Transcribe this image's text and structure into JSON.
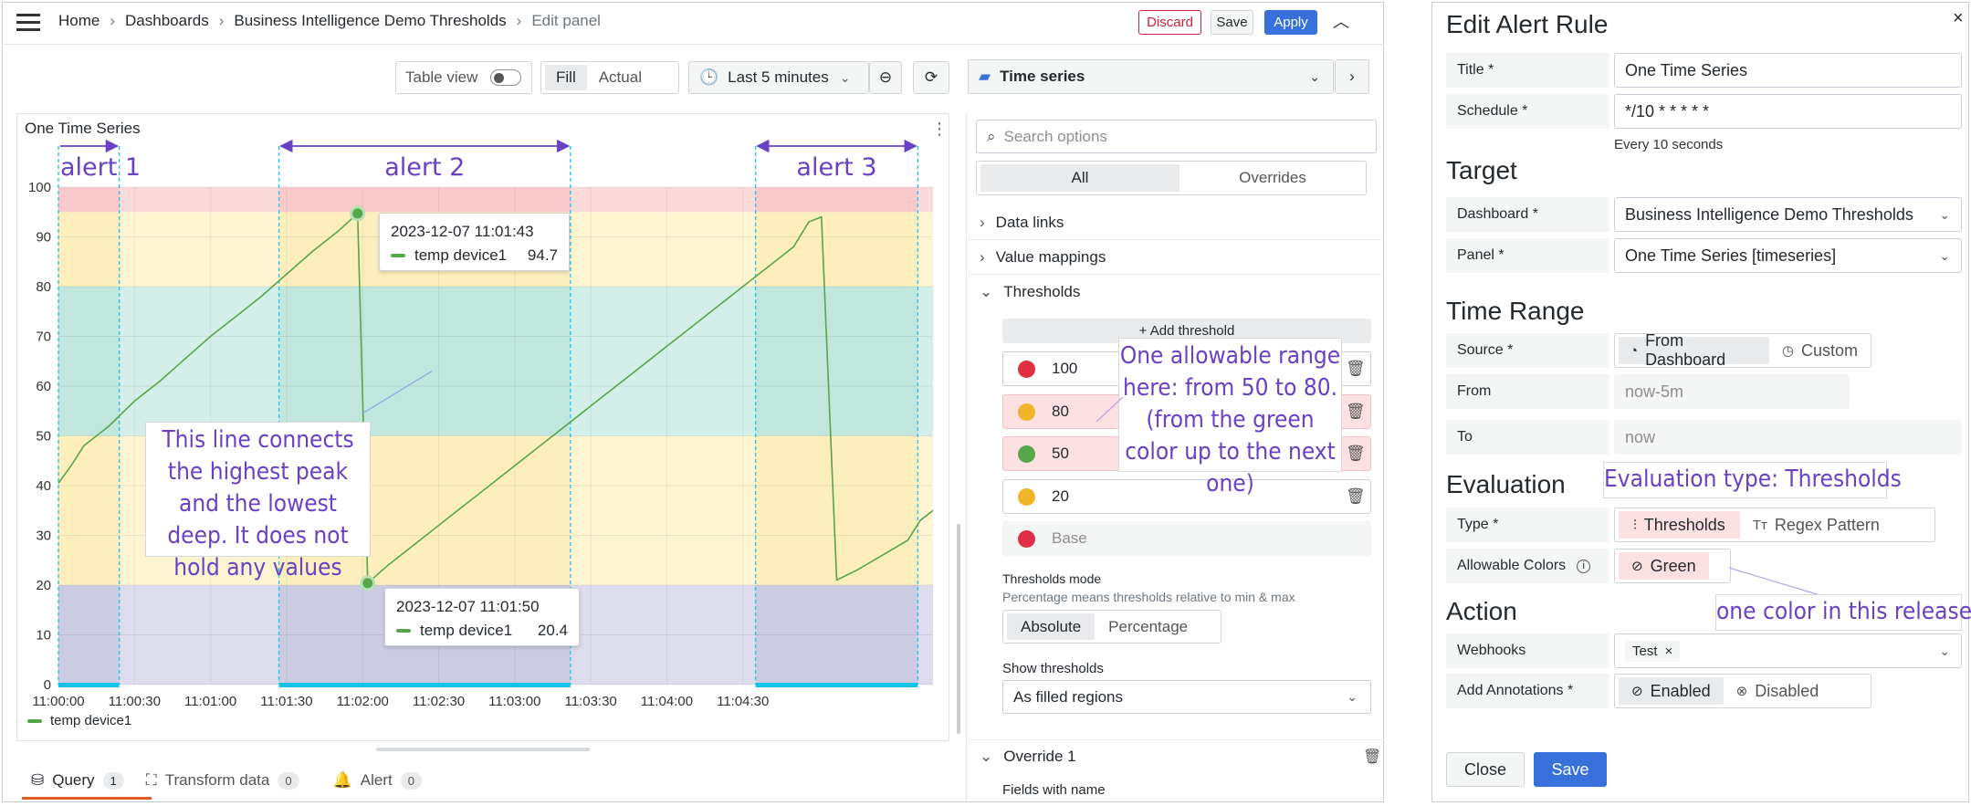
{
  "breadcrumb": {
    "items": [
      "Home",
      "Dashboards",
      "Business Intelligence Demo Thresholds"
    ],
    "current": "Edit panel"
  },
  "top_actions": {
    "discard": "Discard",
    "save": "Save",
    "apply": "Apply"
  },
  "toolbar": {
    "table_view": "Table view",
    "fill": "Fill",
    "actual": "Actual",
    "time_range": "Last 5 minutes",
    "viz_type": "Time series"
  },
  "panel": {
    "title": "One Time Series",
    "legend": "temp device1"
  },
  "chart_data": {
    "type": "line",
    "title": "One Time Series",
    "x_ticks": [
      "11:00:00",
      "11:00:30",
      "11:01:00",
      "11:01:30",
      "11:02:00",
      "11:02:30",
      "11:03:00",
      "11:03:30",
      "11:04:00",
      "11:04:30"
    ],
    "y_ticks": [
      0,
      10,
      20,
      30,
      40,
      50,
      60,
      70,
      80,
      90,
      100
    ],
    "ylim": [
      0,
      100
    ],
    "series": [
      {
        "name": "temp device1",
        "color": "#56a64b",
        "points": [
          [
            0,
            40.5
          ],
          [
            5,
            44
          ],
          [
            10,
            48
          ],
          [
            20,
            52
          ],
          [
            30,
            57
          ],
          [
            40,
            61
          ],
          [
            50,
            65.5
          ],
          [
            60,
            70
          ],
          [
            70,
            74
          ],
          [
            80,
            78
          ],
          [
            90,
            82.5
          ],
          [
            100,
            87
          ],
          [
            110,
            91
          ],
          [
            118,
            94.7
          ],
          [
            122,
            20.4
          ],
          [
            130,
            24
          ],
          [
            140,
            28
          ],
          [
            150,
            32
          ],
          [
            160,
            36
          ],
          [
            170,
            40
          ],
          [
            180,
            44
          ],
          [
            190,
            48
          ],
          [
            200,
            52
          ],
          [
            210,
            56
          ],
          [
            220,
            60
          ],
          [
            230,
            64
          ],
          [
            240,
            68
          ],
          [
            250,
            72
          ],
          [
            260,
            76
          ],
          [
            270,
            80
          ],
          [
            280,
            84
          ],
          [
            290,
            88
          ],
          [
            296,
            93
          ],
          [
            301,
            94
          ],
          [
            307,
            21
          ],
          [
            315,
            23
          ],
          [
            325,
            26
          ],
          [
            335,
            29
          ],
          [
            340,
            33
          ],
          [
            345,
            35
          ]
        ]
      }
    ],
    "threshold_bands": [
      {
        "from": 0,
        "to": 20,
        "color": "#dcdcec"
      },
      {
        "from": 20,
        "to": 50,
        "color": "#fdf4d2"
      },
      {
        "from": 50,
        "to": 80,
        "color": "#d4efe9"
      },
      {
        "from": 80,
        "to": 95,
        "color": "#fdf4d2"
      },
      {
        "from": 95,
        "to": 100,
        "color": "#fbdadc"
      }
    ],
    "alerts": [
      {
        "label": "alert 1",
        "from": 0,
        "to": 24
      },
      {
        "label": "alert 2",
        "from": 87,
        "to": 202
      },
      {
        "label": "alert 3",
        "from": 275,
        "to": 339
      }
    ],
    "tooltips": [
      {
        "time": "2023-12-07 11:01:43",
        "series": "temp device1",
        "value": "94.7",
        "x": 118,
        "y": 94.7
      },
      {
        "time": "2023-12-07 11:01:50",
        "series": "temp device1",
        "value": "20.4",
        "x": 122,
        "y": 20.4
      }
    ],
    "connector_from": [
      122,
      20.4
    ],
    "connector_to": [
      125,
      63
    ]
  },
  "bottom_tabs": [
    {
      "label": "Query",
      "count": "1"
    },
    {
      "label": "Transform data",
      "count": "0"
    },
    {
      "label": "Alert",
      "count": "0"
    }
  ],
  "options": {
    "search_placeholder": "Search options",
    "tab_all": "All",
    "tab_overrides": "Overrides",
    "data_links": "Data links",
    "value_mappings": "Value mappings",
    "thresholds": "Thresholds",
    "add_threshold": "+ Add threshold",
    "threshold_values": [
      {
        "value": "100",
        "color": "#e02f44"
      },
      {
        "value": "80",
        "color": "#f2b52a"
      },
      {
        "value": "50",
        "color": "#56a64b"
      },
      {
        "value": "20",
        "color": "#f2b52a"
      },
      {
        "value": "Base",
        "color": "#e02f44"
      }
    ],
    "thresholds_mode": "Thresholds mode",
    "thresholds_mode_help": "Percentage means thresholds relative to min & max",
    "absolute": "Absolute",
    "percentage": "Percentage",
    "show_thresholds": "Show thresholds",
    "show_thresholds_value": "As filled regions",
    "override_1": "Override 1",
    "fields_with_name": "Fields with name"
  },
  "annotations": {
    "connector_note": "This line connects the highest peak and the lowest deep. It does not hold any values",
    "range_note": "One allowable range here: from 50 to 80. (from the green color up to the next one)",
    "eval_note": "Evaluation type: Thresholds",
    "color_note": "one color in this release"
  },
  "dialog": {
    "title": "Edit Alert Rule",
    "close": "×",
    "title_label": "Title *",
    "title_value": "One Time Series",
    "schedule_label": "Schedule *",
    "schedule_value": "*/10 * * * * *",
    "schedule_help": "Every 10 seconds",
    "target": "Target",
    "dashboard_label": "Dashboard *",
    "dashboard_value": "Business Intelligence Demo Thresholds",
    "panel_label": "Panel *",
    "panel_value": "One Time Series [timeseries]",
    "time_range": "Time Range",
    "source_label": "Source *",
    "from_dashboard": "From Dashboard",
    "custom": "Custom",
    "from_label": "From",
    "from_value": "now-5m",
    "to_label": "To",
    "to_value": "now",
    "evaluation": "Evaluation",
    "type_label": "Type *",
    "thresholds": "Thresholds",
    "regex": "Regex Pattern",
    "colors_label": "Allowable Colors",
    "green": "Green",
    "action": "Action",
    "webhooks_label": "Webhooks",
    "webhook_tag": "Test",
    "annotations_label": "Add Annotations *",
    "enabled": "Enabled",
    "disabled": "Disabled",
    "close_btn": "Close",
    "save_btn": "Save"
  }
}
